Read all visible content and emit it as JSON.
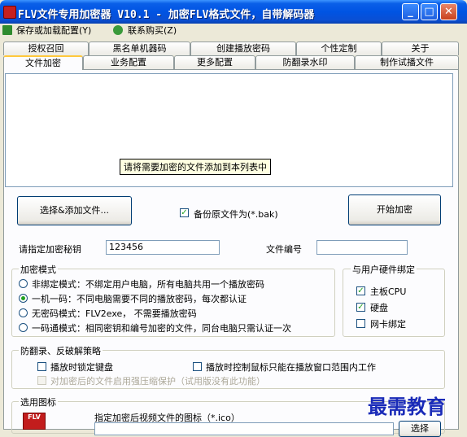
{
  "window": {
    "title": "FLV文件专用加密器 V10.1 - 加密FLV格式文件，自带解码器"
  },
  "menu": {
    "save_load": "保存或加载配置(Y)",
    "contact": "联系购买(Z)"
  },
  "tabs_row1": [
    "授权召回",
    "黑名单机器码",
    "创建播放密码",
    "个性定制",
    "关于"
  ],
  "tabs_row2": [
    "文件加密",
    "业务配置",
    "更多配置",
    "防翻录水印",
    "制作试播文件"
  ],
  "active_tab": "文件加密",
  "filelist": {
    "hint": "请将需要加密的文件添加到本列表中"
  },
  "actions": {
    "select_add": "选择&添加文件...",
    "backup_label": "备份原文件为(*.bak)",
    "backup_checked": true,
    "start": "开始加密"
  },
  "key": {
    "label": "请指定加密秘钥",
    "value": "123456",
    "file_no_label": "文件编号",
    "file_no_value": ""
  },
  "mode": {
    "legend": "加密模式",
    "options": [
      {
        "label": "非绑定模式：不绑定用户电脑，所有电脑共用一个播放密码",
        "selected": false
      },
      {
        "label": "一机一码：不同电脑需要不同的播放密码，每次都认证",
        "selected": true
      },
      {
        "label": "无密码模式：FLV2exe， 不需要播放密码",
        "selected": false
      },
      {
        "label": "一码通模式：相同密钥和编号加密的文件，同台电脑只需认证一次",
        "selected": false
      }
    ]
  },
  "hardware": {
    "legend": "与用户硬件绑定",
    "options": [
      {
        "label": "主板CPU",
        "checked": true
      },
      {
        "label": "硬盘",
        "checked": true
      },
      {
        "label": "网卡绑定",
        "checked": false
      }
    ]
  },
  "anticrack": {
    "legend": "防翻录、反破解策略",
    "lock_keyboard": "播放时锁定键盘",
    "mouse_limit": "播放时控制鼠标只能在播放窗口范围内工作",
    "compress": "对加密后的文件启用强压缩保护（试用版没有此功能）"
  },
  "icon_section": {
    "legend": "选用图标",
    "label": "指定加密后视频文件的图标（*.ico）",
    "browse": "选择",
    "icon_caption": "FLV"
  },
  "watermark": "最需教育"
}
